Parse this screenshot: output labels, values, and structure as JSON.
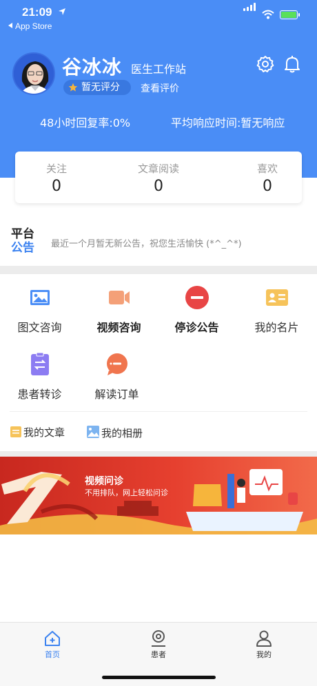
{
  "status_bar": {
    "time": "21:09",
    "back_label": "App Store"
  },
  "profile": {
    "name": "谷冰冰",
    "role": "医生工作站",
    "rating": "暂无评分",
    "view_reviews": "查看评价",
    "reply_rate": "48小时回复率:0%",
    "response_time": "平均响应时间:暂无响应"
  },
  "stats": [
    {
      "label": "关注",
      "value": "0"
    },
    {
      "label": "文章阅读",
      "value": "0"
    },
    {
      "label": "喜欢",
      "value": "0"
    }
  ],
  "notice": {
    "logo_line1": "平台",
    "logo_line2": "公告",
    "text": "最近一个月暂无新公告，祝您生活愉快 (*^_^*)"
  },
  "grid": [
    {
      "label": "图文咨询",
      "icon": "image-chat-icon"
    },
    {
      "label": "视频咨询",
      "icon": "video-camera-icon"
    },
    {
      "label": "停诊公告",
      "icon": "stop-circle-icon"
    },
    {
      "label": "我的名片",
      "icon": "business-card-icon"
    },
    {
      "label": "患者转诊",
      "icon": "transfer-icon"
    },
    {
      "label": "解读订单",
      "icon": "chat-bubble-icon"
    }
  ],
  "links": [
    {
      "label": "我的文章",
      "icon": "article-icon"
    },
    {
      "label": "我的相册",
      "icon": "album-icon"
    }
  ],
  "banner": {
    "title": "视频问诊",
    "subtitle": "不用排队，网上轻松问诊"
  },
  "tabs": [
    {
      "label": "首页",
      "icon": "home-icon",
      "active": true
    },
    {
      "label": "患者",
      "icon": "patients-icon",
      "active": false
    },
    {
      "label": "我的",
      "icon": "profile-icon",
      "active": false
    }
  ],
  "colors": {
    "header_blue": "#4a8df6",
    "accent_blue": "#3b82f0",
    "stop_red": "#e84545",
    "video_orange": "#f4a078",
    "card_yellow": "#f6c35a",
    "transfer_purple": "#8c7cf2",
    "bubble_orange": "#f0754e"
  }
}
